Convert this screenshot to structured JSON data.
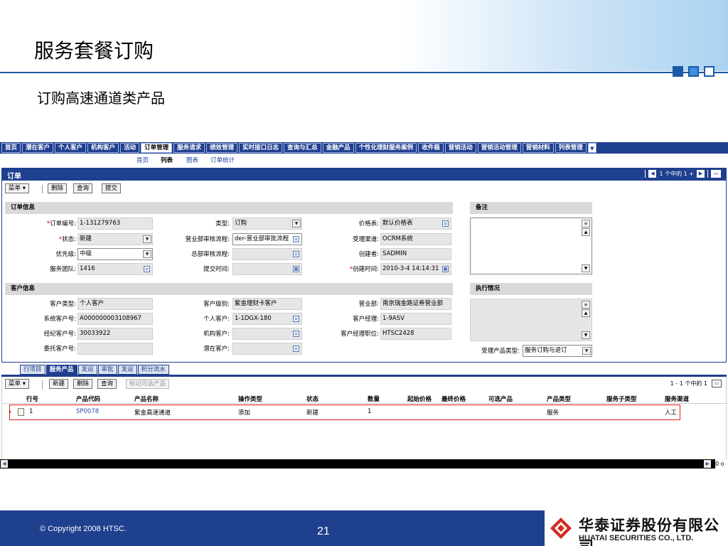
{
  "slide": {
    "title": "服务套餐订购",
    "subtitle": "订购高速通道类产品",
    "copyright": "© Copyright 2008 HTSC.",
    "page_number": "21",
    "company_cn": "华泰证券股份有限公司",
    "company_en": "HUATAI SECURITIES CO., LTD."
  },
  "nav": {
    "tabs": [
      "首页",
      "潜在客户",
      "个人客户",
      "机构客户",
      "活动",
      "订单管理",
      "服务请求",
      "绩效管理",
      "实时接口日志",
      "查询与汇总",
      "金融产品",
      "个性化理财服务案例",
      "收件箱",
      "营销活动",
      "营销活动管理",
      "营销材料",
      "列表管理"
    ],
    "active_tab": "订单管理",
    "sub": [
      "首页",
      "列表",
      "图表",
      "订单统计"
    ]
  },
  "order": {
    "title": "订单",
    "pager": "1 个中的 1 +",
    "buttons": {
      "menu": "菜单",
      "delete": "删除",
      "query": "查询",
      "submit": "提交"
    },
    "section_order": "订单信息",
    "section_note": "备注",
    "section_customer": "客户信息",
    "section_exec": "执行情况",
    "fields": {
      "order_no_label": "订单编号:",
      "order_no": "1-131279763",
      "status_label": "状态:",
      "status": "新建",
      "priority_label": "优先级:",
      "priority": "中级",
      "team_label": "服务团队:",
      "team": "1416",
      "type_label": "类型:",
      "type": "订购",
      "dept_flow_label": "营业部审核流程:",
      "dept_flow": "der-营业部审批流程",
      "hq_flow_label": "总部审核流程:",
      "hq_flow": "",
      "submit_time_label": "提交时间:",
      "submit_time": "",
      "price_label": "价格表:",
      "price": "默认价格表",
      "channel_label": "受理渠道:",
      "channel": "OCRM系统",
      "creator_label": "创建者:",
      "creator": "SADMIN",
      "created_label": "创建时间:",
      "created": "2010-3-4 14:14:31"
    },
    "customer": {
      "ctype_label": "客户类型:",
      "ctype": "个人客户",
      "sysno_label": "系统客户号:",
      "sysno": "A000000003108967",
      "brokerno_label": "经纪客户号:",
      "brokerno": "30033922",
      "trustno_label": "委托客户号:",
      "trustno": "",
      "level_label": "客户级别:",
      "level": "紫金理财卡客户",
      "person_label": "个人客户:",
      "person": "1-1DGX-180",
      "org_label": "机构客户:",
      "org": "",
      "potential_label": "潜在客户:",
      "potential": "",
      "branch_label": "营业部:",
      "branch": "南京瑞金路证券营业部",
      "manager_label": "客户经理:",
      "manager": "1-9ASV",
      "mgrpos_label": "客户经理职位:",
      "mgrpos": "HTSC2428"
    },
    "accept_type_label": "受理产品类型:",
    "accept_type": "服务订购与退订"
  },
  "detail": {
    "tabs": [
      "行项目",
      "服务产品",
      "发运",
      "审批",
      "发运",
      "积分流水"
    ],
    "active_tab": "服务产品",
    "buttons": {
      "menu": "菜单",
      "new": "新建",
      "delete": "删除",
      "query": "查询",
      "mark": "标记可选产品"
    },
    "pager": "1 - 1 个中的 1",
    "columns": [
      "行号",
      "产品代码",
      "产品名称",
      "操作类型",
      "状态",
      "数量",
      "起始价格",
      "最终价格",
      "可选产品",
      "产品类型",
      "服务子类型",
      "服务渠道"
    ],
    "rows": [
      {
        "line": "1",
        "code": "SP0078",
        "name": "紫金高速通道",
        "op": "添加",
        "status": "新建",
        "qty": "1",
        "ptype": "服务",
        "channel": "人工"
      }
    ],
    "scroll_tail": "0 o"
  },
  "colors": {
    "brand": "#1f3f8f",
    "highlight": "#e02020",
    "slide_rule": "#1b5aa5"
  }
}
